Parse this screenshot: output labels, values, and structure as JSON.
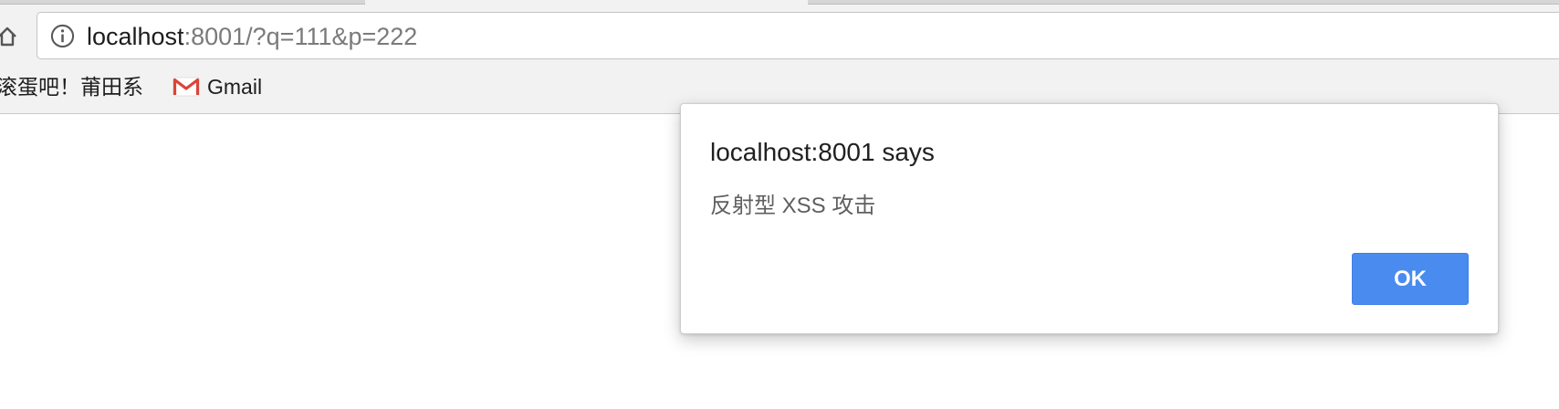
{
  "browser": {
    "address_bar": {
      "url_host": "localhost",
      "url_rest": ":8001/?q=111&p=222",
      "info_icon": "info-icon"
    },
    "home_icon": "home-icon",
    "bookmarks": [
      {
        "label": "滚蛋吧！莆田系"
      },
      {
        "label": "Gmail",
        "icon": "gmail-icon"
      }
    ]
  },
  "dialog": {
    "title": "localhost:8001 says",
    "message": "反射型 XSS 攻击",
    "ok_label": "OK"
  },
  "colors": {
    "chrome_background": "#f2f2f2",
    "ok_button": "#4a8bf0",
    "message_text": "#5f5f5f",
    "gmail_red": "#db4437"
  }
}
